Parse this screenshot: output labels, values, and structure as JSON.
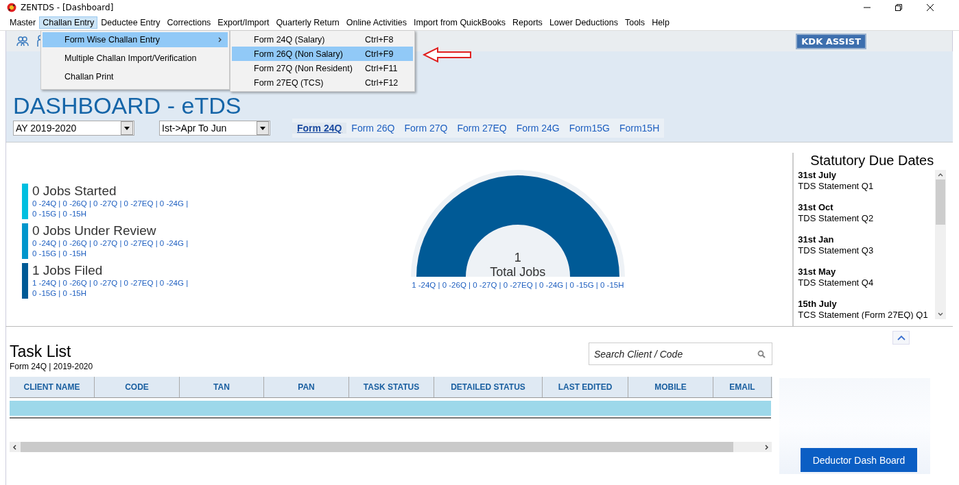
{
  "window": {
    "title": "ZENTDS - [Dashboard]"
  },
  "menu_bar": [
    {
      "label": "Master",
      "selected": false
    },
    {
      "label": "Challan Entry",
      "selected": true
    },
    {
      "label": "Deductee Entry",
      "selected": false
    },
    {
      "label": "Corrections",
      "selected": false
    },
    {
      "label": "Export/Import",
      "selected": false
    },
    {
      "label": "Quarterly Return",
      "selected": false
    },
    {
      "label": "Online Activities",
      "selected": false
    },
    {
      "label": "Import from QuickBooks",
      "selected": false
    },
    {
      "label": "Reports",
      "selected": false
    },
    {
      "label": "Lower Deductions",
      "selected": false
    },
    {
      "label": "Tools",
      "selected": false
    },
    {
      "label": "Help",
      "selected": false
    }
  ],
  "challan_menu": [
    {
      "label": "Form Wise Challan Entry",
      "selected": true,
      "submenu": true
    },
    {
      "label": "Multiple Challan Import/Verification",
      "selected": false,
      "submenu": false
    },
    {
      "label": "Challan Print",
      "selected": false,
      "submenu": false
    }
  ],
  "submenu": [
    {
      "label": "Form 24Q (Salary)",
      "shortcut": "Ctrl+F8",
      "selected": false
    },
    {
      "label": "Form 26Q (Non Salary)",
      "shortcut": "Ctrl+F9",
      "selected": true
    },
    {
      "label": "Form 27Q (Non Resident)",
      "shortcut": "Ctrl+F11",
      "selected": false
    },
    {
      "label": "Form 27EQ (TCS)",
      "shortcut": "Ctrl+F12",
      "selected": false
    }
  ],
  "toolbar": {
    "assist_button": "KDK ASSIST"
  },
  "dashboard": {
    "title": "DASHBOARD - eTDS",
    "year": "AY 2019-2020",
    "quarter": "Ist->Apr To Jun",
    "form_tabs": [
      {
        "label": "Form 24Q",
        "selected": true
      },
      {
        "label": "Form 26Q",
        "selected": false
      },
      {
        "label": "Form 27Q",
        "selected": false
      },
      {
        "label": "Form 27EQ",
        "selected": false
      },
      {
        "label": "Form 24G",
        "selected": false
      },
      {
        "label": "Form15G",
        "selected": false
      },
      {
        "label": "Form15H",
        "selected": false
      }
    ]
  },
  "jobs": [
    {
      "title": "0 Jobs Started",
      "line_1": "0 -24Q | 0 -26Q | 0 -27Q | 0 -27EQ | 0 -24G |",
      "line_2": "0 -15G | 0 -15H",
      "color": "#00bfe0"
    },
    {
      "title": "0 Jobs Under Review",
      "line_1": "0 -24Q | 0 -26Q | 0 -27Q | 0 -27EQ | 0 -24G |",
      "line_2": "0 -15G | 0 -15H",
      "color": "#0096cc"
    },
    {
      "title": "1 Jobs Filed",
      "line_1": "1 -24Q | 0 -26Q | 0 -27Q | 0 -27EQ | 0 -24G |",
      "line_2": "0 -15G | 0 -15H",
      "color": "#005a96"
    }
  ],
  "gauge": {
    "count": "1",
    "label": "Total Jobs",
    "breakdown": "1 -24Q | 0 -26Q | 0 -27Q | 0 -27EQ | 0 -24G | 0 -15G | 0 -15H"
  },
  "due_dates": {
    "title": "Statutory Due Dates",
    "items": [
      {
        "date": "31st July",
        "text": "TDS Statement Q1"
      },
      {
        "date": "31st Oct",
        "text": "TDS Statement Q2"
      },
      {
        "date": "31st Jan",
        "text": "TDS Statement Q3"
      },
      {
        "date": "31st May",
        "text": "TDS Statement Q4"
      },
      {
        "date": "15th July",
        "text": "TCS Statement (Form 27EQ) Q1"
      }
    ]
  },
  "task_list": {
    "title": "Task List",
    "subtitle": "Form 24Q | 2019-2020",
    "search": {
      "placeholder": "Search Client / Code"
    },
    "columns": [
      "CLIENT NAME",
      "CODE",
      "TAN",
      "PAN",
      "TASK STATUS",
      "DETAILED STATUS",
      "LAST EDITED",
      "MOBILE",
      "EMAIL"
    ]
  },
  "deductor_button": "Deductor Dash Board"
}
